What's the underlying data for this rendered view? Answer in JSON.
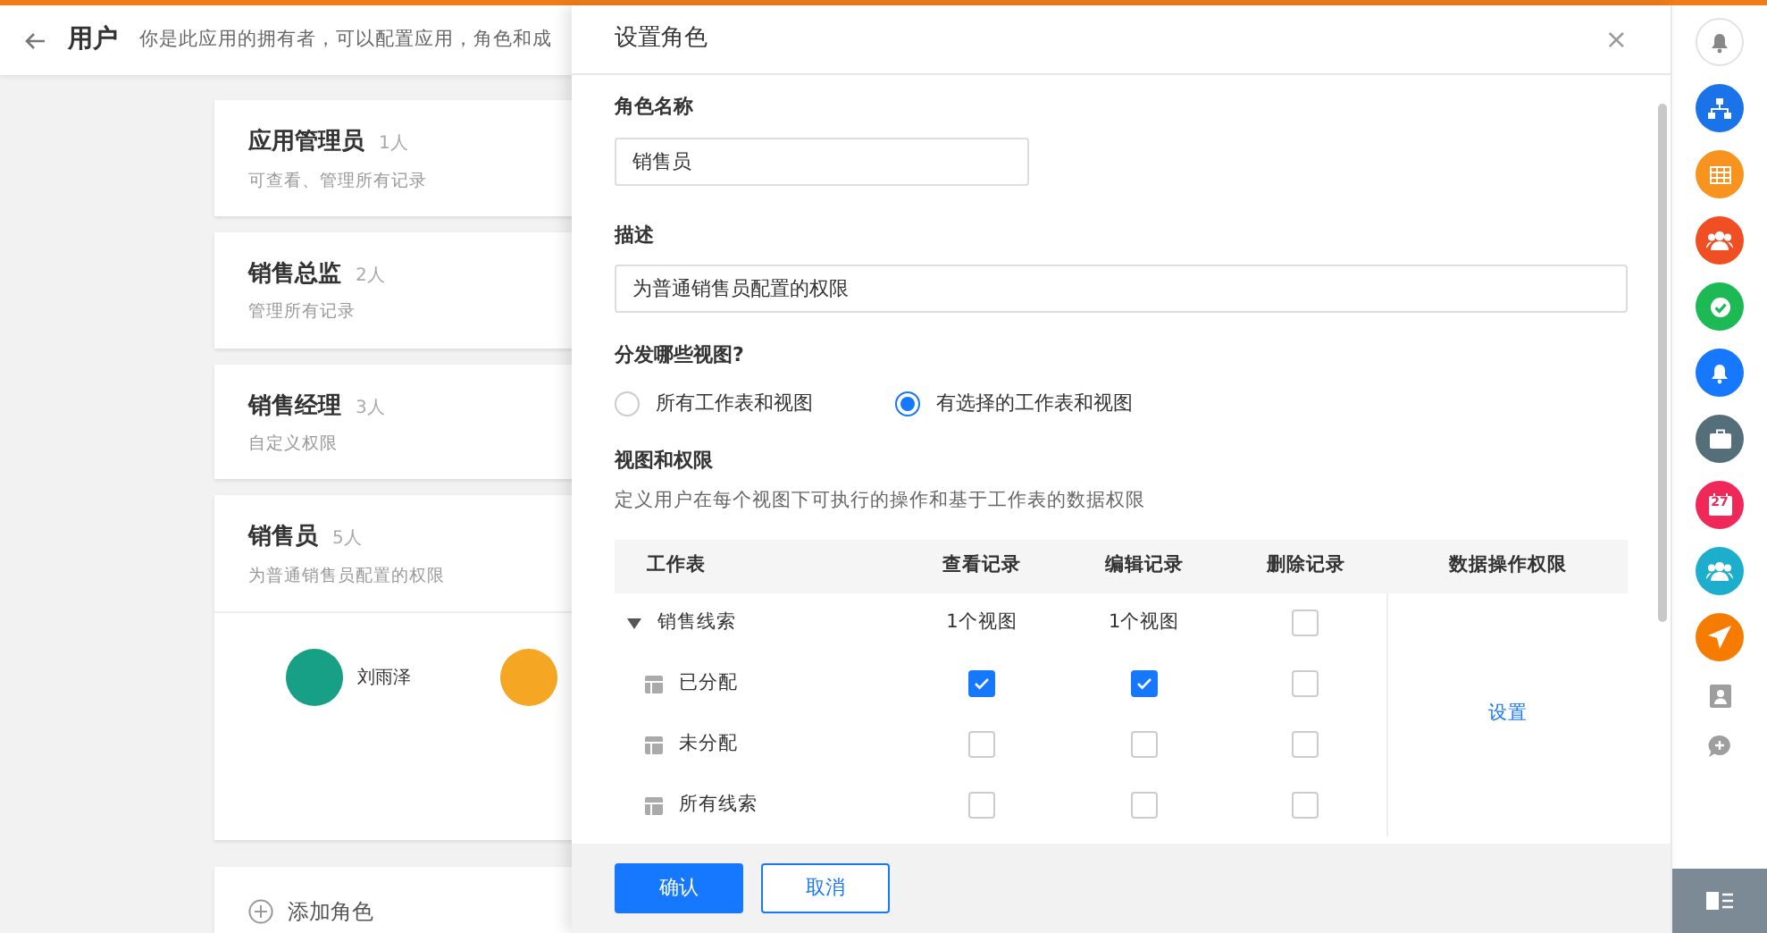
{
  "header": {
    "title": "用户",
    "description": "你是此应用的拥有者，可以配置应用，角色和成"
  },
  "roles": [
    {
      "name": "应用管理员",
      "count": "1人",
      "description": "可查看、管理所有记录",
      "expanded": false
    },
    {
      "name": "销售总监",
      "count": "2人",
      "description": "管理所有记录",
      "expanded": false
    },
    {
      "name": "销售经理",
      "count": "3人",
      "description": "自定义权限",
      "expanded": false
    },
    {
      "name": "销售员",
      "count": "5人",
      "description": "为普通销售员配置的权限",
      "expanded": true,
      "members": [
        {
          "name": "刘雨泽",
          "color": "#17a085"
        },
        {
          "color": "#f5a623"
        }
      ]
    }
  ],
  "add_role": "添加角色",
  "dialog": {
    "title": "设置角色",
    "close": "×",
    "name_label": "角色名称",
    "name_value": "销售员",
    "desc_label": "描述",
    "desc_value": "为普通销售员配置的权限",
    "scope_label": "分发哪些视图?",
    "scope_options": [
      {
        "label": "所有工作表和视图",
        "selected": false
      },
      {
        "label": "有选择的工作表和视图",
        "selected": true
      }
    ],
    "perm_label": "视图和权限",
    "perm_desc": "定义用户在每个视图下可执行的操作和基于工作表的数据权限",
    "table": {
      "columns": [
        "工作表",
        "查看记录",
        "编辑记录",
        "删除记录",
        "数据操作权限"
      ],
      "rows": [
        {
          "kind": "group",
          "name": "销售线索",
          "expanded": true,
          "view": "1个视图",
          "edit": "1个视图",
          "delete": false
        },
        {
          "kind": "view",
          "name": "已分配",
          "view": true,
          "edit": true,
          "delete": false
        },
        {
          "kind": "view",
          "name": "未分配",
          "view": false,
          "edit": false,
          "delete": false
        },
        {
          "kind": "view",
          "name": "所有线索",
          "view": false,
          "edit": false,
          "delete": false
        }
      ],
      "data_action": "设置"
    },
    "buttons": [
      {
        "label": "确认",
        "kind": "primary"
      },
      {
        "label": "取消",
        "kind": "secondary"
      }
    ]
  },
  "sidebar": [
    {
      "kind": "bell",
      "color": "#ffffff"
    },
    {
      "kind": "org",
      "color": "#1a73e8"
    },
    {
      "kind": "grid",
      "color": "#f7931e"
    },
    {
      "kind": "group",
      "color": "#f04e23"
    },
    {
      "kind": "check",
      "color": "#1db954"
    },
    {
      "kind": "bell",
      "color": "#1677ff"
    },
    {
      "kind": "briefcase",
      "color": "#546e7a"
    },
    {
      "kind": "calendar",
      "color": "#f0285a",
      "label": "27"
    },
    {
      "kind": "group",
      "color": "#1eaecd"
    },
    {
      "kind": "send",
      "color": "#f57c00"
    },
    {
      "kind": "contact",
      "color": "#9e9e9e"
    },
    {
      "kind": "chat",
      "color": "#9e9e9e"
    },
    {
      "kind": "panel",
      "color": "#7b8a94"
    }
  ]
}
